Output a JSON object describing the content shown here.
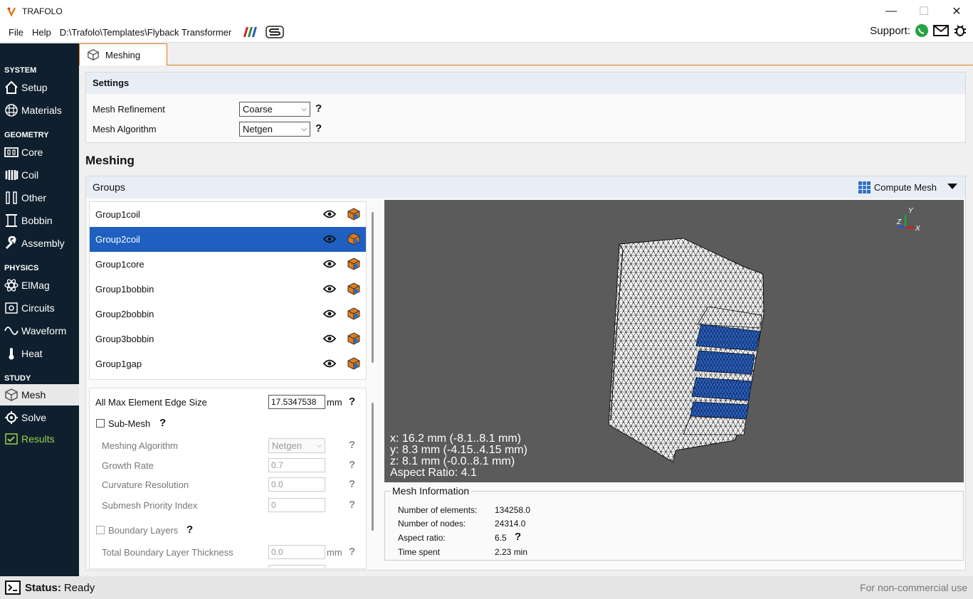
{
  "window": {
    "title": "TRAFOLO",
    "minimize": "—",
    "maximize": "☐",
    "close": "✕"
  },
  "menu": {
    "file": "File",
    "help": "Help",
    "path": "D:\\Trafolo\\Templates\\Flyback Transformer"
  },
  "support": {
    "label": "Support:"
  },
  "sidebar": {
    "system": "SYSTEM",
    "setup": "Setup",
    "materials": "Materials",
    "geometry": "GEOMETRY",
    "core": "Core",
    "coil": "Coil",
    "other": "Other",
    "bobbin": "Bobbin",
    "assembly": "Assembly",
    "physics": "PHYSICS",
    "elmag": "ElMag",
    "circuits": "Circuits",
    "waveform": "Waveform",
    "heat": "Heat",
    "study": "STUDY",
    "mesh": "Mesh",
    "solve": "Solve",
    "results": "Results"
  },
  "tab": {
    "label": "Meshing"
  },
  "settings": {
    "title": "Settings",
    "refinement_label": "Mesh Refinement",
    "refinement_value": "Coarse",
    "algorithm_label": "Mesh Algorithm",
    "algorithm_value": "Netgen",
    "help": "?"
  },
  "meshing": {
    "title": "Meshing"
  },
  "groups": {
    "title": "Groups",
    "compute": "Compute Mesh",
    "items": [
      "Group1coil",
      "Group2coil",
      "Group1core",
      "Group1bobbin",
      "Group2bobbin",
      "Group3bobbin",
      "Group1gap"
    ],
    "selected": "Group2coil"
  },
  "props": {
    "max_edge_label": "All Max Element Edge Size",
    "max_edge_value": "17.5347538",
    "unit": "mm",
    "submesh_label": "Sub-Mesh",
    "meshing_algorithm_label": "Meshing Algorithm",
    "meshing_algorithm_value": "Netgen",
    "growth_rate_label": "Growth Rate",
    "growth_rate_value": "0.7",
    "curvature_label": "Curvature Resolution",
    "curvature_value": "0.0",
    "priority_label": "Submesh Priority Index",
    "priority_value": "0",
    "boundary_layers_label": "Boundary Layers",
    "thickness_label": "Total Boundary Layer Thickness",
    "thickness_value": "0.0",
    "help": "?"
  },
  "viewer": {
    "x": "x: 16.2 mm (-8.1..8.1 mm)",
    "y": "y: 8.3 mm (-4.15..4.15 mm)",
    "z": "z: 8.1 mm (-0.0..8.1 mm)",
    "aspect": "Aspect Ratio: 4.1",
    "axis_x": "X",
    "axis_y": "Y",
    "axis_z": "Z"
  },
  "mesh_info": {
    "title": "Mesh Information",
    "elements_label": "Number of elements:",
    "elements_value": "134258.0",
    "nodes_label": "Number of nodes:",
    "nodes_value": "24314.0",
    "aspect_label": "Aspect ratio:",
    "aspect_value": "6.5",
    "time_label": "Time spent",
    "time_value": "2.23 min",
    "help": "?"
  },
  "status": {
    "label": "Status:",
    "value": "Ready",
    "license": "For non-commercial use"
  },
  "colors": {
    "accent": "#e07b1a",
    "sidebar": "#0f1f2e",
    "selection": "#1f5fbf",
    "viewer_bg": "#5b5b5b",
    "results": "#9bd04a"
  }
}
